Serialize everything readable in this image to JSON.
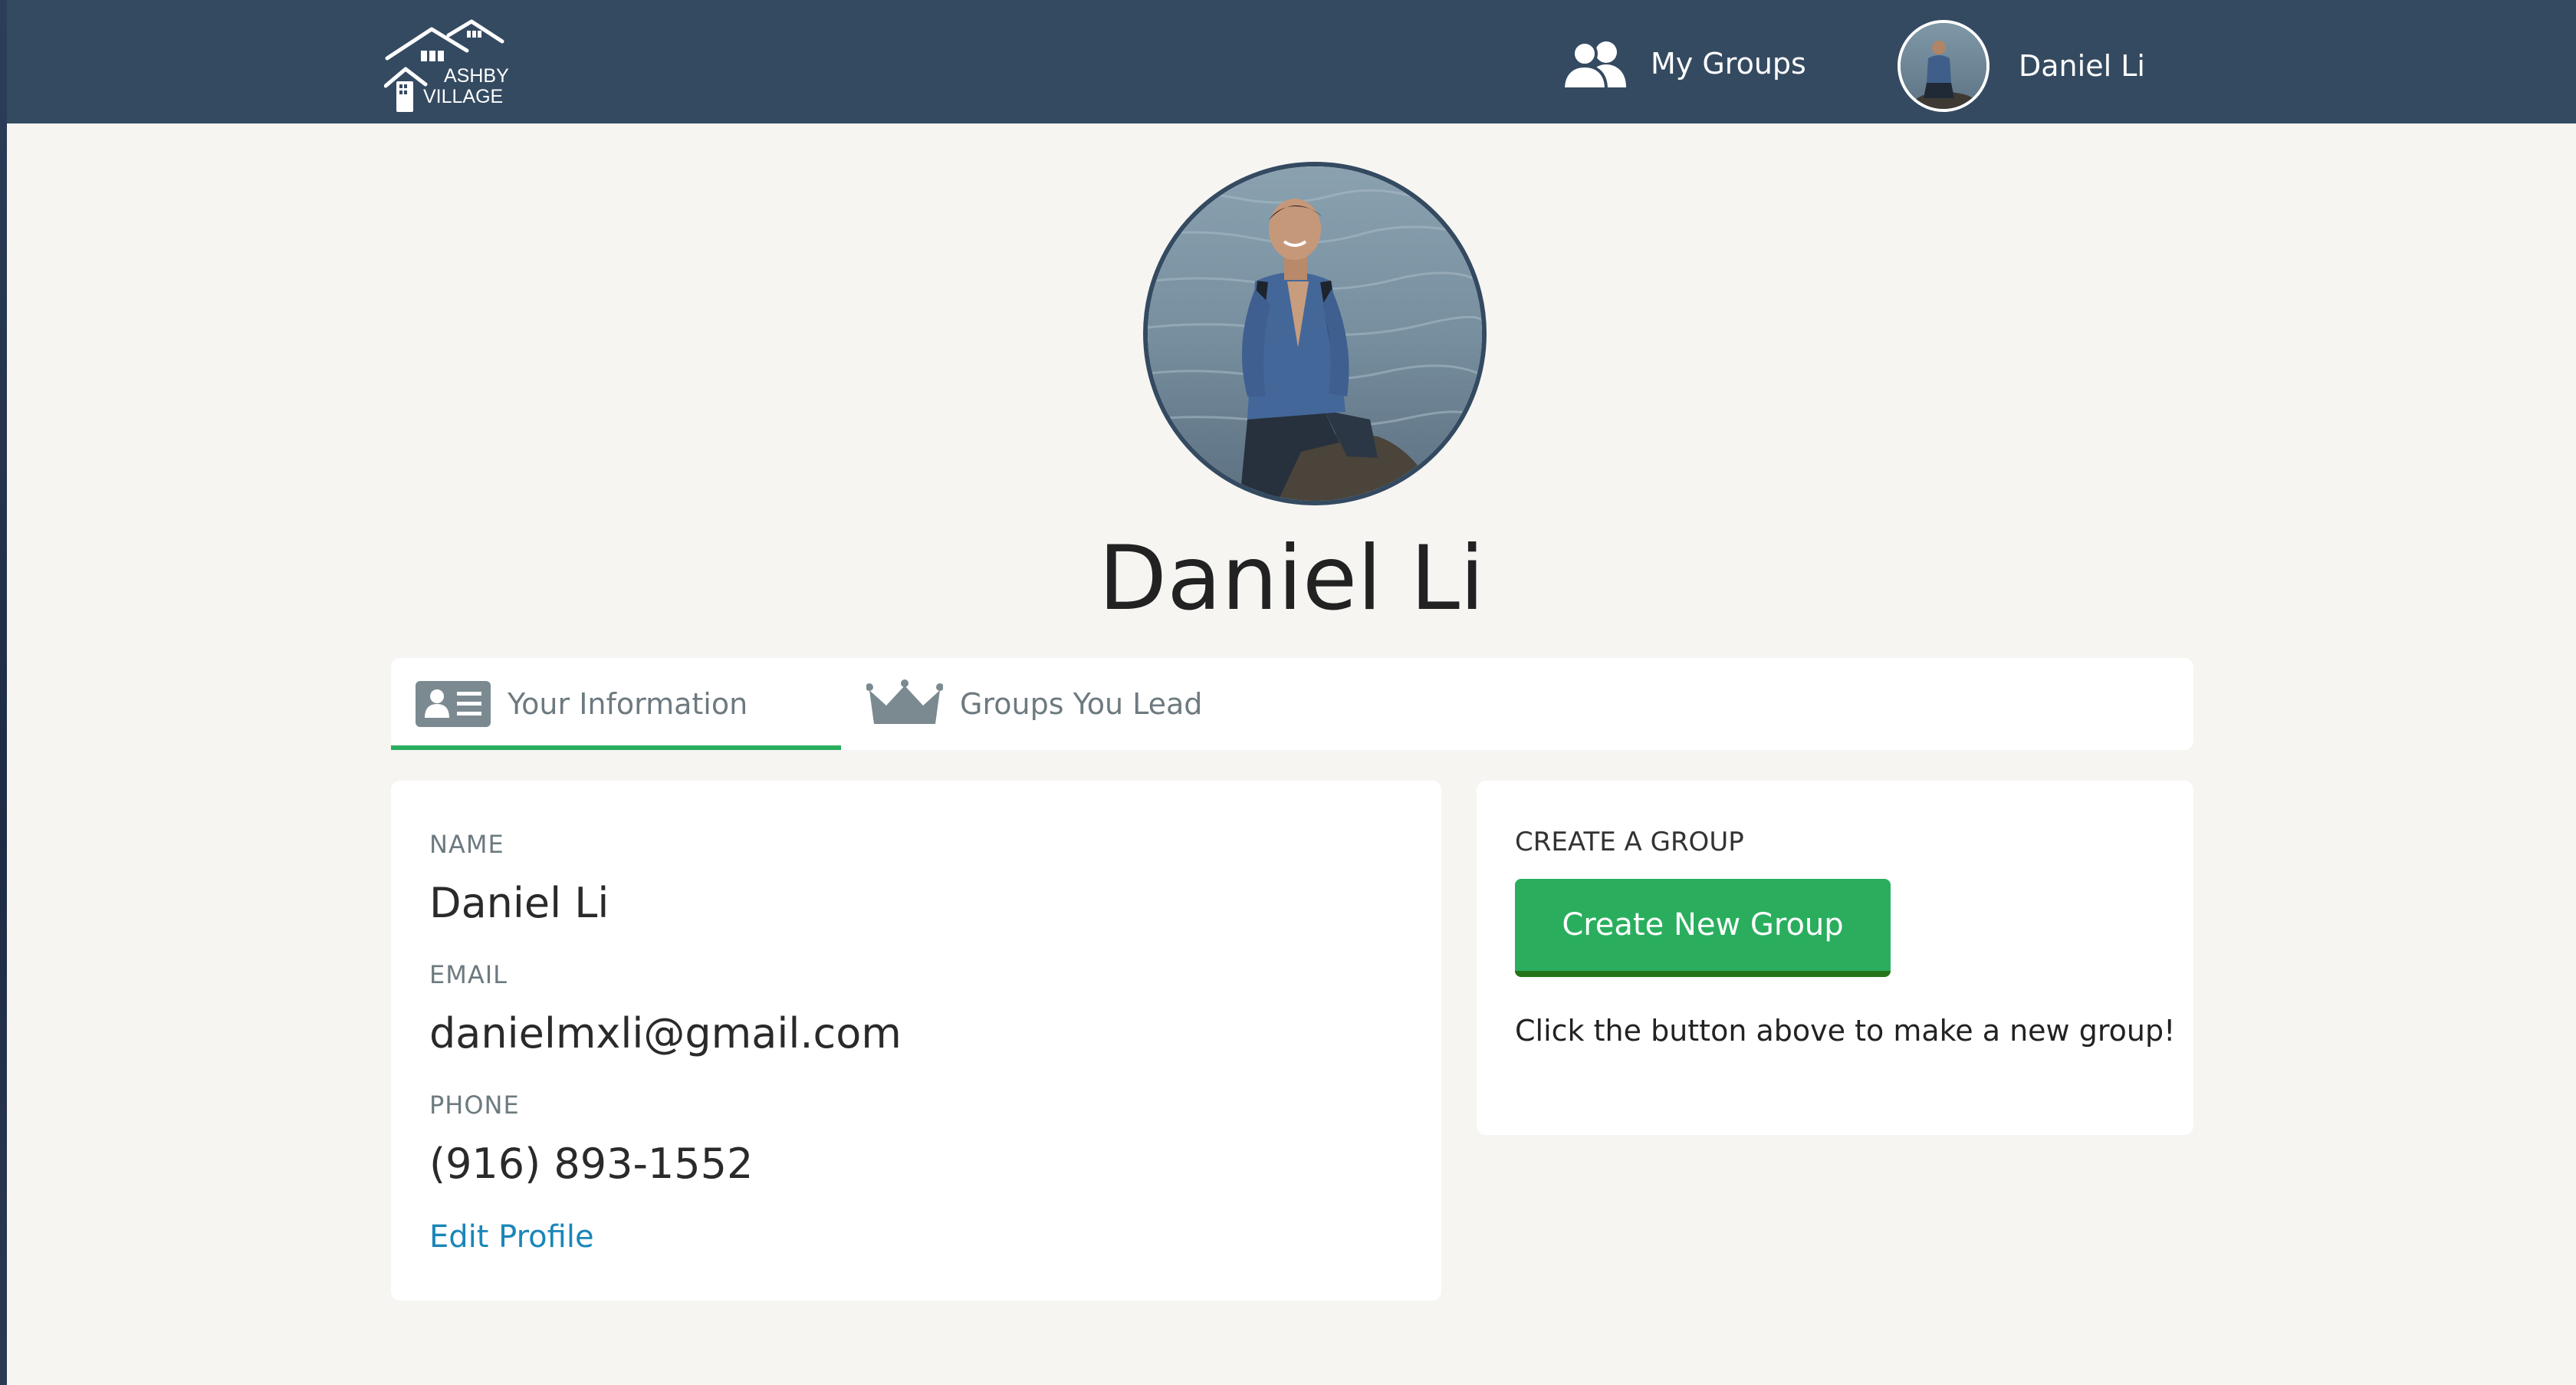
{
  "header": {
    "logo_line1": "ASHBY",
    "logo_line2": "VILLAGE",
    "my_groups_label": "My Groups",
    "user_name": "Daniel Li"
  },
  "profile": {
    "name": "Daniel Li"
  },
  "tabs": [
    {
      "label": "Your Information",
      "icon": "id-card-icon",
      "active": true
    },
    {
      "label": "Groups You Lead",
      "icon": "crown-icon",
      "active": false
    }
  ],
  "info_card": {
    "name_label": "NAME",
    "name_value": "Daniel Li",
    "email_label": "EMAIL",
    "email_value": "danielmxli@gmail.com",
    "phone_label": "PHONE",
    "phone_value": "(916) 893-1552",
    "edit_link": "Edit Profile"
  },
  "group_card": {
    "heading": "CREATE A GROUP",
    "button_label": "Create New Group",
    "description": "Click the button above to make a new group!"
  },
  "colors": {
    "navbar": "#344a61",
    "background": "#f6f5f2",
    "accent_green": "#2aae5e",
    "link_blue": "#1a86b8"
  }
}
